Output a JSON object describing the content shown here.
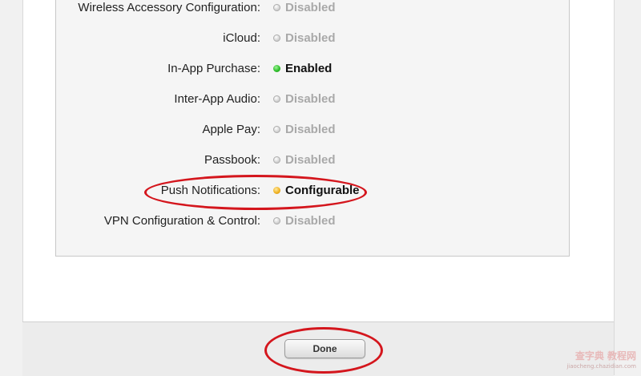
{
  "capabilities": [
    {
      "label": "Wireless Accessory Configuration:",
      "status": "Disabled",
      "state": "disabled"
    },
    {
      "label": "iCloud:",
      "status": "Disabled",
      "state": "disabled"
    },
    {
      "label": "In-App Purchase:",
      "status": "Enabled",
      "state": "enabled"
    },
    {
      "label": "Inter-App Audio:",
      "status": "Disabled",
      "state": "disabled"
    },
    {
      "label": "Apple Pay:",
      "status": "Disabled",
      "state": "disabled"
    },
    {
      "label": "Passbook:",
      "status": "Disabled",
      "state": "disabled"
    },
    {
      "label": "Push Notifications:",
      "status": "Configurable",
      "state": "configurable"
    },
    {
      "label": "VPN Configuration & Control:",
      "status": "Disabled",
      "state": "disabled"
    }
  ],
  "footer": {
    "done_label": "Done"
  },
  "watermark": {
    "text": "查字典 教程网",
    "sub": "jiaocheng.chazidian.com"
  },
  "colors": {
    "enabled": "#2fbf2b",
    "configurable": "#f0b323",
    "disabled": "#c0c0c0",
    "annotation": "#d4161d"
  }
}
